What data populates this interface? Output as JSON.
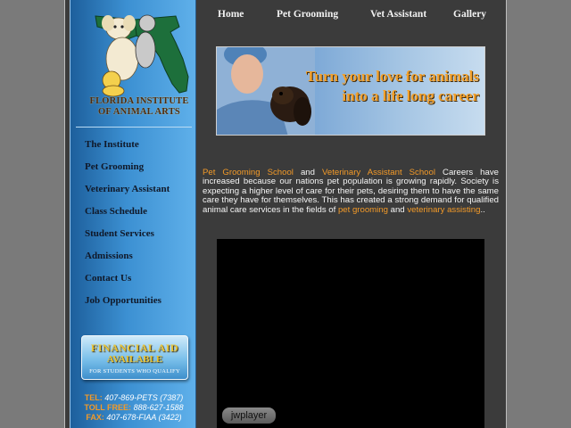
{
  "site": {
    "logo_text_line1": "FLORIDA INSTITUTE",
    "logo_text_line2": "OF ANIMAL ARTS"
  },
  "topnav": [
    "Home",
    "Pet Grooming",
    "Vet Assistant",
    "Gallery"
  ],
  "sidebar_nav": [
    "The Institute",
    "Pet Grooming",
    "Veterinary Assistant",
    "Class Schedule",
    "Student Services",
    "Admissions",
    "Contact Us",
    "Job Opportunities"
  ],
  "financial_aid": {
    "line1": "FINANCIAL AID",
    "line2": "AVAILABLE",
    "line3": "FOR STUDENTS WHO QUALIFY"
  },
  "contact": {
    "tel_label": "TEL:",
    "tel_value": "407-869-PETS",
    "tel_extra": "(7387)",
    "tollfree_label": "TOLL FREE:",
    "tollfree_value": "888-627-1588",
    "fax_label": "FAX:",
    "fax_value": "407-678-FIAA",
    "fax_extra": "(3422)"
  },
  "banner": {
    "line1": "Turn your love for animals",
    "line2": "into a life long career"
  },
  "intro": {
    "link1": "Pet Grooming School",
    "and1": " and ",
    "link2": "Veterinary Assistant School",
    "text1": " Careers have increased because our nations pet population is growing  rapidly. Society is expecting a higher level of care for their pets, desiring them to have the same care they have for themselves. This has created a strong demand for qualified animal care services in the fields of ",
    "link3": "pet grooming",
    "and2": " and ",
    "link4": "veterinary assisting",
    "end": ".."
  },
  "video": {
    "player_label": "jwplayer"
  },
  "colors": {
    "accent_orange": "#f39a28",
    "sidebar_blue": "#3c90d2",
    "content_bg": "#3b3b3b",
    "page_bg": "#7a7a7a"
  }
}
